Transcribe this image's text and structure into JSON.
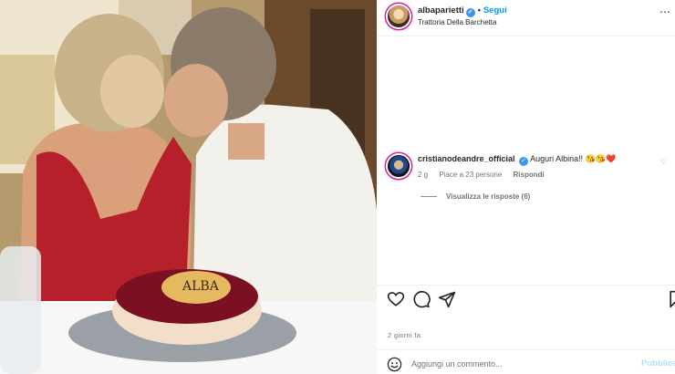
{
  "post": {
    "image_alt": "Couple kissing behind a birthday cake",
    "cake_text": "ALBA"
  },
  "header": {
    "username": "albaparietti",
    "separator": "•",
    "follow_label": "Segui",
    "location": "Trattoria Della Barchetta",
    "more_icon": "more-horizontal-icon"
  },
  "comment": {
    "username": "cristianodeandre_official",
    "text": "Auguri Albina!! 😘😘❤️",
    "time": "2 g",
    "likes": "Piace a 23 persone",
    "reply_label": "Rispondi",
    "view_replies": "Visualizza le risposte (6)"
  },
  "actions": {
    "like_icon": "heart-icon",
    "comment_icon": "comment-icon",
    "share_icon": "send-icon",
    "save_icon": "bookmark-icon"
  },
  "date": "2 giorni fa",
  "add_comment": {
    "placeholder": "Aggiungi un commento...",
    "publish_label": "Pubblica"
  },
  "colors": {
    "accent": "#0095f6",
    "verified": "#3897f0",
    "publish_disabled": "#b2dffc",
    "text_primary": "#262626",
    "text_secondary": "#737373"
  }
}
